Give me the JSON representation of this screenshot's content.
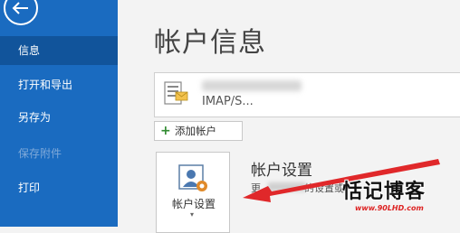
{
  "sidebar": {
    "items": [
      {
        "label": "信息",
        "state": "active"
      },
      {
        "label": "打开和导出",
        "state": "normal"
      },
      {
        "label": "另存为",
        "state": "normal"
      },
      {
        "label": "保存附件",
        "state": "disabled"
      },
      {
        "label": "打印",
        "state": "normal"
      }
    ]
  },
  "main": {
    "title": "帐户信息",
    "account": {
      "type": "IMAP/S..."
    },
    "add_account_label": "添加帐户",
    "settings_tile_label": "帐户设置",
    "settings_heading": "帐户设置",
    "settings_desc_prefix": "更",
    "settings_desc_suffix": "的设置或"
  },
  "watermark": {
    "text": "恬记博客",
    "url": "www.90LHD.com"
  },
  "colors": {
    "sidebar": "#1a6bc0",
    "sidebar_active": "#11549b",
    "arrow": "#e0282a"
  }
}
